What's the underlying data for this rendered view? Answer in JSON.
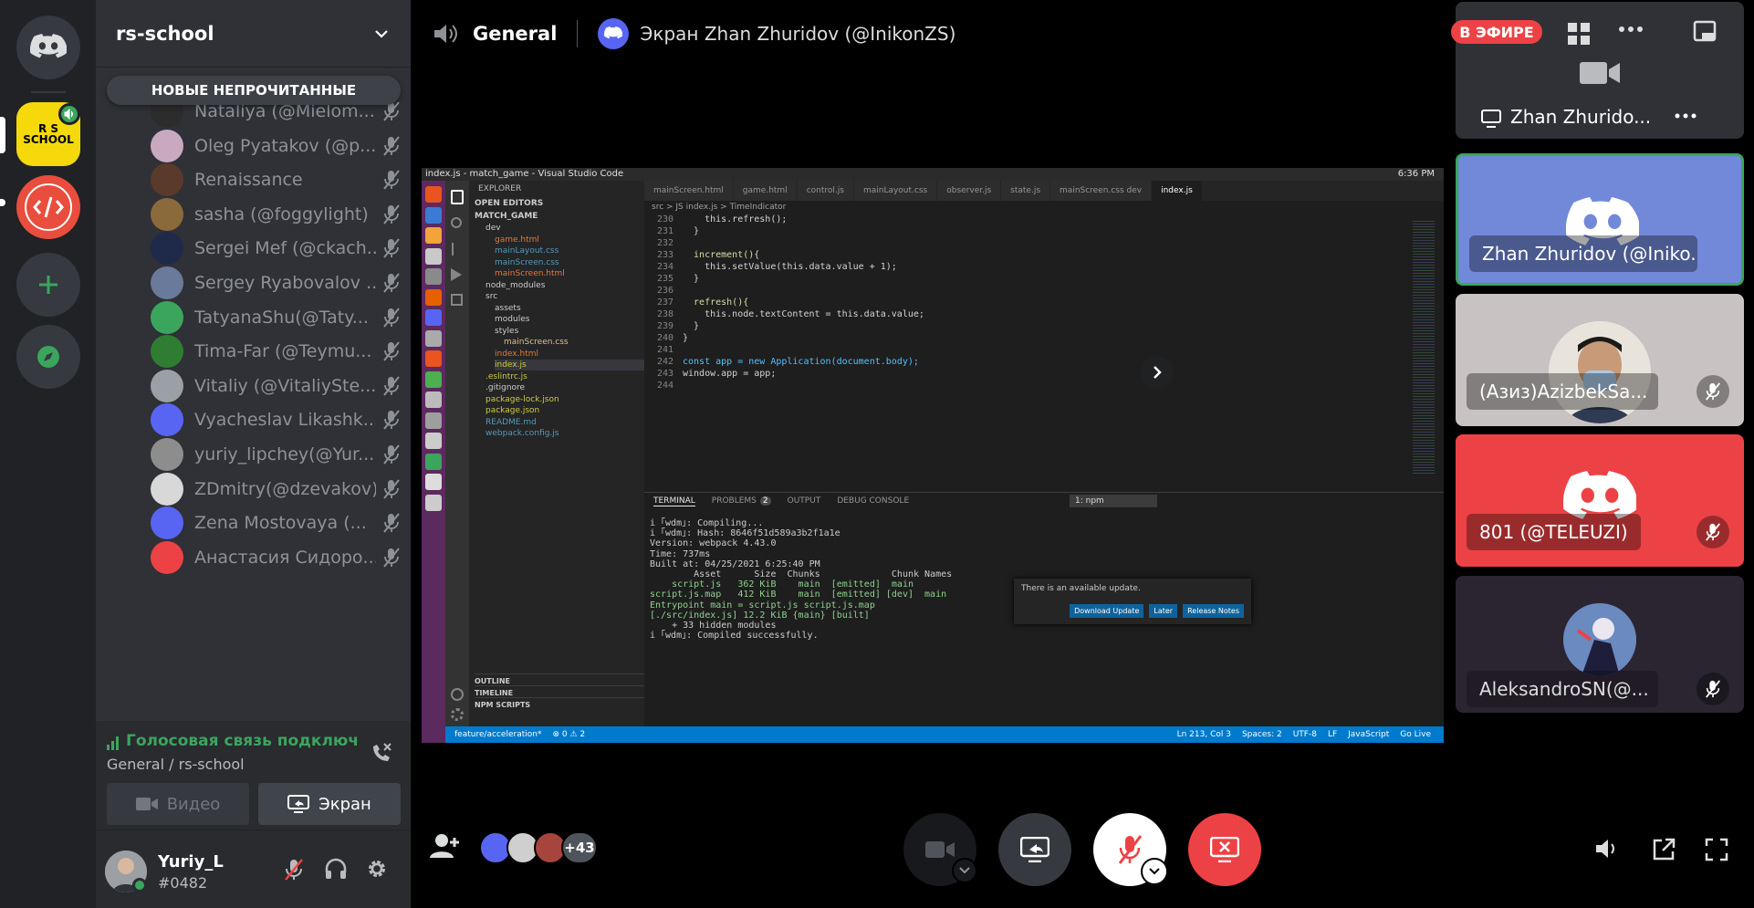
{
  "server": {
    "name": "rs-school",
    "unread_pill": "НОВЫЕ НЕПРОЧИТАННЫЕ"
  },
  "members": [
    {
      "name": "Nataliya (@Mielom...",
      "avatar_color": "#2c2c2c"
    },
    {
      "name": "Oleg Pyatakov (@p...",
      "avatar_color": "#c9a9c0"
    },
    {
      "name": "Renaissance",
      "avatar_color": "#5a3a2a"
    },
    {
      "name": "sasha (@foggylight)",
      "avatar_color": "#8a6a3a"
    },
    {
      "name": "Sergei Mef (@ckach...",
      "avatar_color": "#1f2a4a"
    },
    {
      "name": "Sergey Ryabovalov ...",
      "avatar_color": "#6a7a9a"
    },
    {
      "name": "TatyanaShu(@Taty...",
      "avatar_color": "#3ba55d"
    },
    {
      "name": "Tima-Far (@Teymu...",
      "avatar_color": "#2e7d32"
    },
    {
      "name": "Vitaliy (@VitaliySte...",
      "avatar_color": "#9aa0a6"
    },
    {
      "name": "Vyacheslav Likashk...",
      "avatar_color": "#5865f2"
    },
    {
      "name": "yuriy_lipchey(@Yur...",
      "avatar_color": "#8d8d8d"
    },
    {
      "name": "ZDmitry(@dzevakov)",
      "avatar_color": "#d8d8d8"
    },
    {
      "name": "Zena Mostovaya (...",
      "avatar_color": "#5865f2"
    },
    {
      "name": "Анастасия Сидоро...",
      "avatar_color": "#ed4245"
    }
  ],
  "voice": {
    "status": "Голосовая связь подключ",
    "channel": "General / rs-school",
    "video_label": "Видео",
    "screen_label": "Экран"
  },
  "user": {
    "name": "Yuriy_L",
    "tag": "#0482"
  },
  "header": {
    "channel": "General",
    "stream_title": "Экран Zhan Zhuridov (@InikonZS)",
    "live_badge": "В ЭФИРЕ"
  },
  "participants": {
    "overflow_count": "+43"
  },
  "tiles": [
    {
      "label": "Zhan Zhurido...",
      "bg": "#2f3136"
    },
    {
      "label": "Zhan Zhuridov (@Iniko...",
      "bg": "#7289da"
    },
    {
      "label": "(Азиз)AzizbekSa...",
      "bg": "#c8c2c2"
    },
    {
      "label": "801 (@TELEUZI)",
      "bg": "#ed4245"
    },
    {
      "label": "AleksandroSN(@...",
      "bg": "#2b2531"
    }
  ],
  "vscode": {
    "title": "index.js - match_game - Visual Studio Code",
    "clock": "6:36 PM",
    "tabs": [
      "mainScreen.html",
      "game.html",
      "control.js",
      "mainLayout.css",
      "observer.js",
      "state.js",
      "mainScreen.css dev",
      "index.js"
    ],
    "breadcrumb": "src > JS index.js > TimeIndicator",
    "explorer_title": "EXPLORER",
    "open_editors": "OPEN EDITORS",
    "project": "MATCH_GAME",
    "files": [
      "dev",
      "game.html",
      "mainLayout.css",
      "mainScreen.css",
      "mainScreen.html",
      "node_modules",
      "src",
      "assets",
      "modules",
      "styles",
      "mainScreen.css",
      "index.html",
      "index.js",
      ".eslintrc.js",
      ".gitignore",
      "package-lock.json",
      "package.json",
      "README.md",
      "webpack.config.js"
    ],
    "line_numbers": [
      "230",
      "231",
      "232",
      "233",
      "234",
      "235",
      "236",
      "237",
      "238",
      "239",
      "240",
      "241",
      "242",
      "243",
      "244"
    ],
    "code_lines": [
      "    this.refresh();",
      "  }",
      "",
      "  increment(){",
      "    this.setValue(this.data.value + 1);",
      "  }",
      "",
      "  refresh(){",
      "    this.node.textContent = this.data.value;",
      "  }",
      "}",
      "",
      "const app = new Application(document.body);",
      "window.app = app;",
      ""
    ],
    "panel_tabs": [
      "TERMINAL",
      "PROBLEMS",
      "OUTPUT",
      "DEBUG CONSOLE"
    ],
    "problems_count": "2",
    "terminal_select": "1: npm",
    "terminal_lines": [
      "i ｢wdm｣: Compiling...",
      "i ｢wdm｣: Hash: 8646f51d589a3b2f1a1e",
      "Version: webpack 4.43.0",
      "Time: 737ms",
      "Built at: 04/25/2021 6:25:40 PM",
      "        Asset      Size  Chunks             Chunk Names",
      "    script.js   362 KiB    main  [emitted]  main",
      "script.js.map   412 KiB    main  [emitted] [dev]  main",
      "Entrypoint main = script.js script.js.map",
      "[./src/index.js] 12.2 KiB {main} [built]",
      "    + 33 hidden modules",
      "i ｢wdm｣: Compiled successfully."
    ],
    "notification": "There is an available update.",
    "notif_buttons": [
      "Download Update",
      "Later",
      "Release Notes"
    ],
    "outline_sections": [
      "OUTLINE",
      "TIMELINE",
      "NPM SCRIPTS"
    ],
    "status_left": [
      "feature/acceleration*",
      "⊗ 0 ⚠ 2"
    ],
    "status_right": [
      "Ln 213, Col 3",
      "Spaces: 2",
      "UTF-8",
      "LF",
      "JavaScript",
      "Go Live"
    ]
  },
  "colors": {
    "blurple": "#5865f2",
    "green": "#3ba55d",
    "red": "#ed4245",
    "bg_dark": "#202225",
    "sidebar": "#2f3136"
  }
}
